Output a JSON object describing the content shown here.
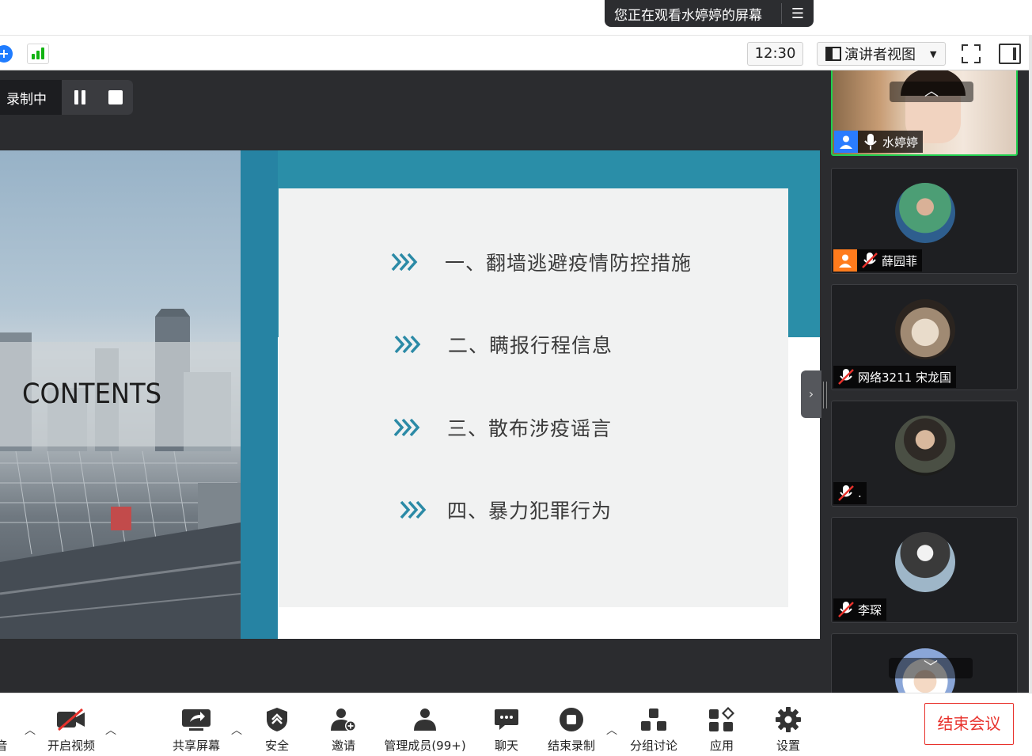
{
  "top_bar": {
    "viewing_text": "您正在观看水婷婷的屏幕",
    "menu_icon": "list-menu-icon"
  },
  "toolbar": {
    "time": "12:30",
    "view_mode": "演讲者视图",
    "icons": [
      "shield-icon",
      "signal-icon",
      "fullscreen-icon",
      "side-panel-icon"
    ]
  },
  "recording": {
    "label": "录制中"
  },
  "slide": {
    "title": "CONTENTS",
    "items": [
      "一、翻墙逃避疫情防控措施",
      "二、瞒报行程信息",
      "三、散布涉疫谣言",
      "四、暴力犯罪行为"
    ]
  },
  "participants": [
    {
      "name": "水婷婷",
      "badge": "blue",
      "muted": false
    },
    {
      "name": "薛园菲",
      "badge": "orange",
      "muted": true
    },
    {
      "name": "网络3211 宋龙国",
      "badge": "",
      "muted": true
    },
    {
      "name": ".",
      "badge": "",
      "muted": true
    },
    {
      "name": "李琛",
      "badge": "",
      "muted": true
    }
  ],
  "bottom_bar": {
    "audio_label": "音",
    "video_label": "开启视频",
    "share_label": "共享屏幕",
    "security_label": "安全",
    "invite_label": "邀请",
    "members_label": "管理成员(99+)",
    "chat_label": "聊天",
    "end_record_label": "结束录制",
    "breakout_label": "分组讨论",
    "apps_label": "应用",
    "settings_label": "设置",
    "end_meeting_label": "结束会议"
  },
  "colors": {
    "accent_teal": "#2a8ea8",
    "active_border": "#1fcf4e",
    "end_red": "#e8322c"
  }
}
